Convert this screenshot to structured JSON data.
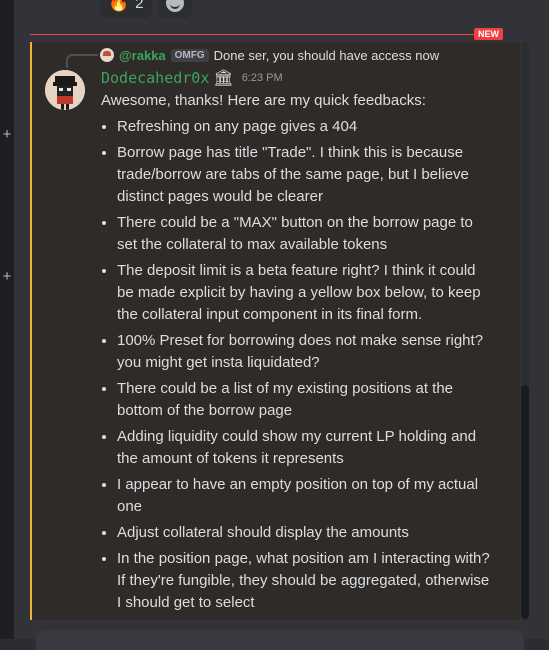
{
  "reactions": [
    {
      "emoji": "🔥",
      "count": "2"
    },
    {
      "icon": "add-reaction-icon"
    }
  ],
  "divider": {
    "badge": "NEW"
  },
  "reply": {
    "name": "@rakka",
    "tag": "OMFG",
    "text": "Done ser, you should have access now"
  },
  "message": {
    "username": "Dodecahedr0x",
    "badge_icon": "🏛",
    "timestamp": "6:23 PM",
    "intro": "Awesome, thanks! Here are my quick feedbacks:",
    "items": [
      "Refreshing on any page gives a 404",
      "Borrow page has title \"Trade\". I think this is because trade/borrow are tabs of the same page, but I believe distinct pages would be clearer",
      "There could be a \"MAX\" button on the borrow page to set the collateral to max available tokens",
      "The deposit limit is a beta feature right? I think it could be made explicit by having a yellow box below, to keep the collateral input component in its final form.",
      "100% Preset for borrowing does not make sense right? you might get insta liquidated?",
      "There could be a list of my existing positions at the bottom of the borrow page",
      "Adding liquidity could show my current LP holding and the amount of tokens it represents",
      "I appear to have an empty position on top of my actual one",
      "Adjust collateral should display the amounts",
      "In the position page, what position am I interacting with? If they're fungible, they should be aggregated, otherwise I should get to select"
    ]
  },
  "rail": {
    "plus": "+"
  },
  "colors": {
    "highlight_border": "#f0b232",
    "username": "#3ba55d",
    "new_divider": "#f23f42"
  }
}
